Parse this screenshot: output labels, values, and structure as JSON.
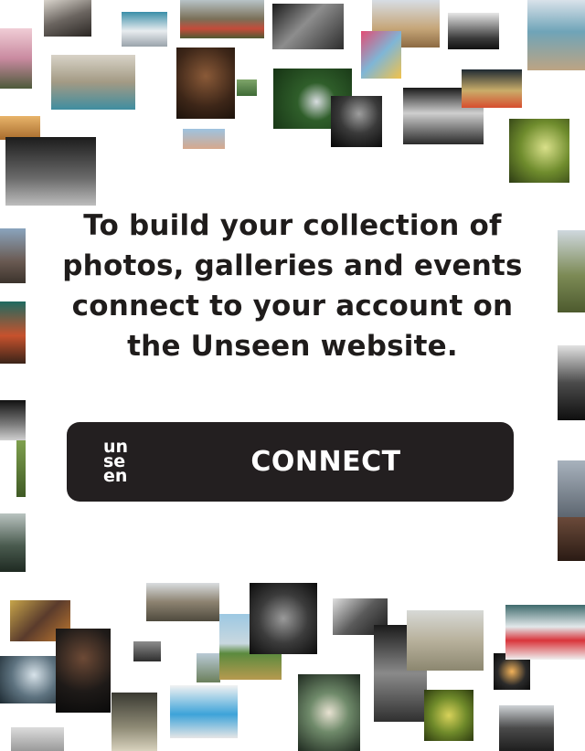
{
  "prompt": {
    "lines": [
      "To build your collection of",
      "photos, galleries and events",
      "connect to your account on",
      "the Unseen website."
    ]
  },
  "connect_button": {
    "logo_lines": [
      "un",
      "se",
      "en"
    ],
    "label": "CONNECT"
  },
  "colors": {
    "button_background": "#231f20",
    "text": "#1f1c1b",
    "background": "#ffffff"
  }
}
